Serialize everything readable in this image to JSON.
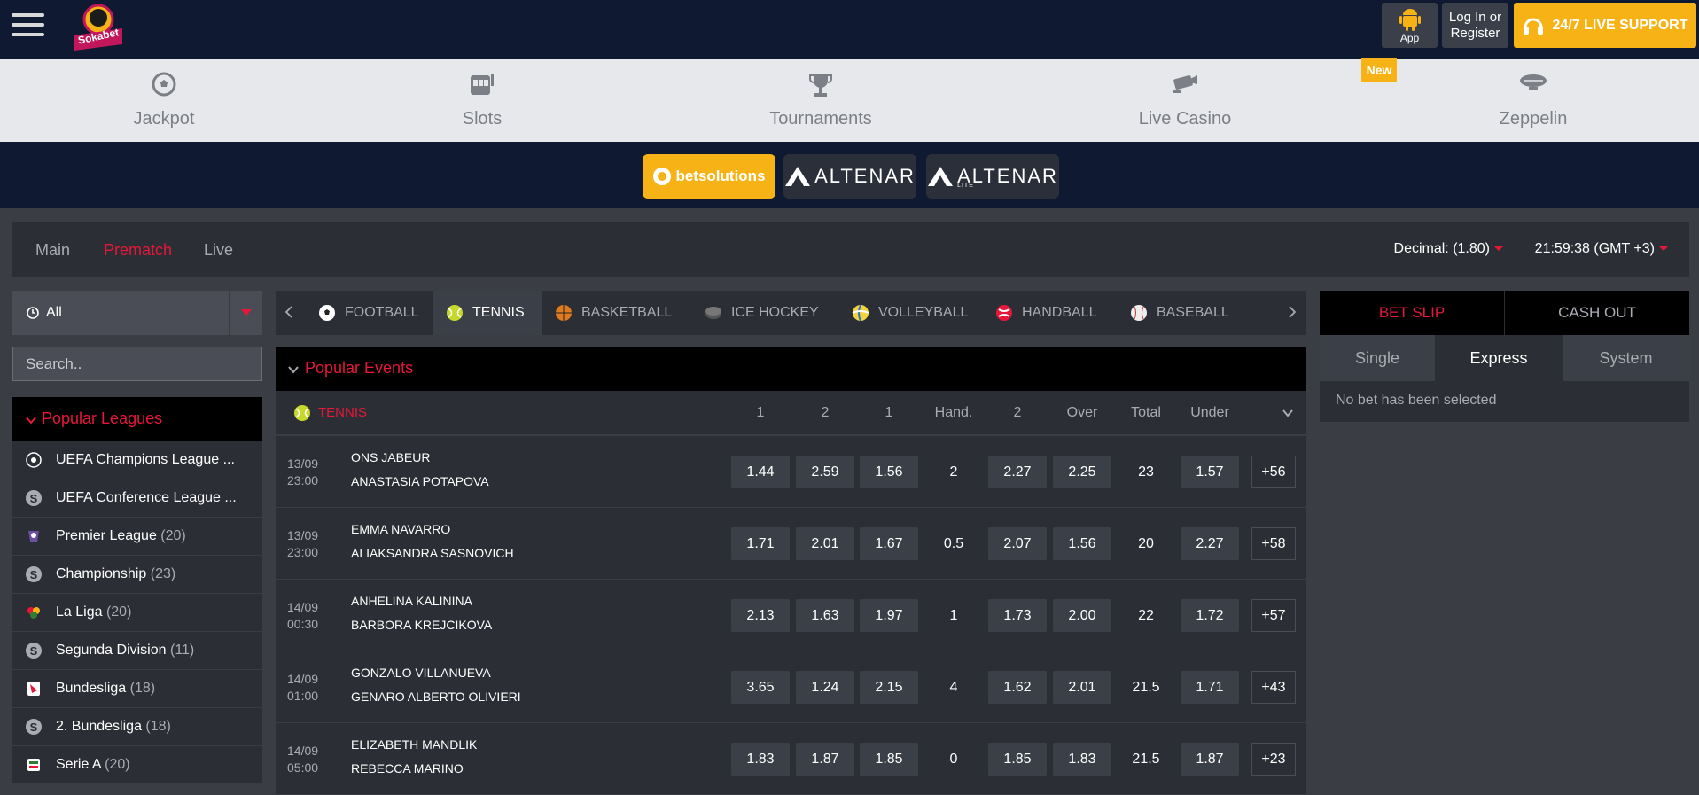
{
  "header": {
    "logo_text": "Sokabet",
    "app_label": "App",
    "login_line1": "Log In or",
    "login_line2": "Register",
    "support_label": "24/7 LIVE SUPPORT"
  },
  "categories": [
    {
      "label": "Jackpot",
      "icon": "soccer-ball-icon"
    },
    {
      "label": "Slots",
      "icon": "slot-machine-icon"
    },
    {
      "label": "Tournaments",
      "icon": "trophy-icon"
    },
    {
      "label": "Live Casino",
      "icon": "camera-icon"
    },
    {
      "label": "Zeppelin",
      "icon": "zeppelin-icon"
    }
  ],
  "new_badge": "New",
  "providers": {
    "betsolutions": "betsolutions",
    "altenar": "ALTENAR",
    "altenar_lite": "ALTENAR",
    "altenar_lite_sub": "LITE"
  },
  "main_tabs": {
    "main": "Main",
    "prematch": "Prematch",
    "live": "Live"
  },
  "odds_format": "Decimal: (1.80)",
  "clock": "21:59:38 (GMT +3)",
  "sidebar": {
    "filter": "All",
    "search_placeholder": "Search..",
    "popular_leagues_title": "Popular Leagues",
    "leagues": [
      {
        "name": "UEFA Champions League ...",
        "count": ""
      },
      {
        "name": "UEFA Conference League ...",
        "count": ""
      },
      {
        "name": "Premier League",
        "count": "(20)"
      },
      {
        "name": "Championship",
        "count": "(23)"
      },
      {
        "name": "La Liga",
        "count": "(20)"
      },
      {
        "name": "Segunda Division",
        "count": "(11)"
      },
      {
        "name": "Bundesliga",
        "count": "(18)"
      },
      {
        "name": "2. Bundesliga",
        "count": "(18)"
      },
      {
        "name": "Serie A",
        "count": "(20)"
      }
    ]
  },
  "sports": [
    "FOOTBALL",
    "TENNIS",
    "BASKETBALL",
    "ICE HOCKEY",
    "VOLLEYBALL",
    "HANDBALL",
    "BASEBALL"
  ],
  "events": {
    "title": "Popular Events",
    "sport_label": "TENNIS",
    "columns": [
      "1",
      "2",
      "1",
      "Hand.",
      "2",
      "Over",
      "Total",
      "Under"
    ],
    "rows": [
      {
        "date": "13/09",
        "time": "23:00",
        "team1": "ONS JABEUR",
        "team2": "ANASTASIA POTAPOVA",
        "odds": [
          "1.44",
          "2.59",
          "1.56",
          "2",
          "2.27",
          "2.25",
          "23",
          "1.57"
        ],
        "more": "+56"
      },
      {
        "date": "13/09",
        "time": "23:00",
        "team1": "EMMA NAVARRO",
        "team2": "ALIAKSANDRA SASNOVICH",
        "odds": [
          "1.71",
          "2.01",
          "1.67",
          "0.5",
          "2.07",
          "1.56",
          "20",
          "2.27"
        ],
        "more": "+58"
      },
      {
        "date": "14/09",
        "time": "00:30",
        "team1": "ANHELINA KALININA",
        "team2": "BARBORA KREJCIKOVA",
        "odds": [
          "2.13",
          "1.63",
          "1.97",
          "1",
          "1.73",
          "2.00",
          "22",
          "1.72"
        ],
        "more": "+57"
      },
      {
        "date": "14/09",
        "time": "01:00",
        "team1": "GONZALO VILLANUEVA",
        "team2": "GENARO ALBERTO OLIVIERI",
        "odds": [
          "3.65",
          "1.24",
          "2.15",
          "4",
          "1.62",
          "2.01",
          "21.5",
          "1.71"
        ],
        "more": "+43"
      },
      {
        "date": "14/09",
        "time": "05:00",
        "team1": "ELIZABETH MANDLIK",
        "team2": "REBECCA MARINO",
        "odds": [
          "1.83",
          "1.87",
          "1.85",
          "0",
          "1.85",
          "1.83",
          "21.5",
          "1.87"
        ],
        "more": "+23"
      }
    ]
  },
  "betslip": {
    "bet_slip": "BET SLIP",
    "cash_out": "CASH OUT",
    "single": "Single",
    "express": "Express",
    "system": "System",
    "empty": "No bet has been selected"
  },
  "colors": {
    "accent": "#e8173a",
    "brand_yellow": "#f7b315",
    "navy": "#0f1931"
  }
}
